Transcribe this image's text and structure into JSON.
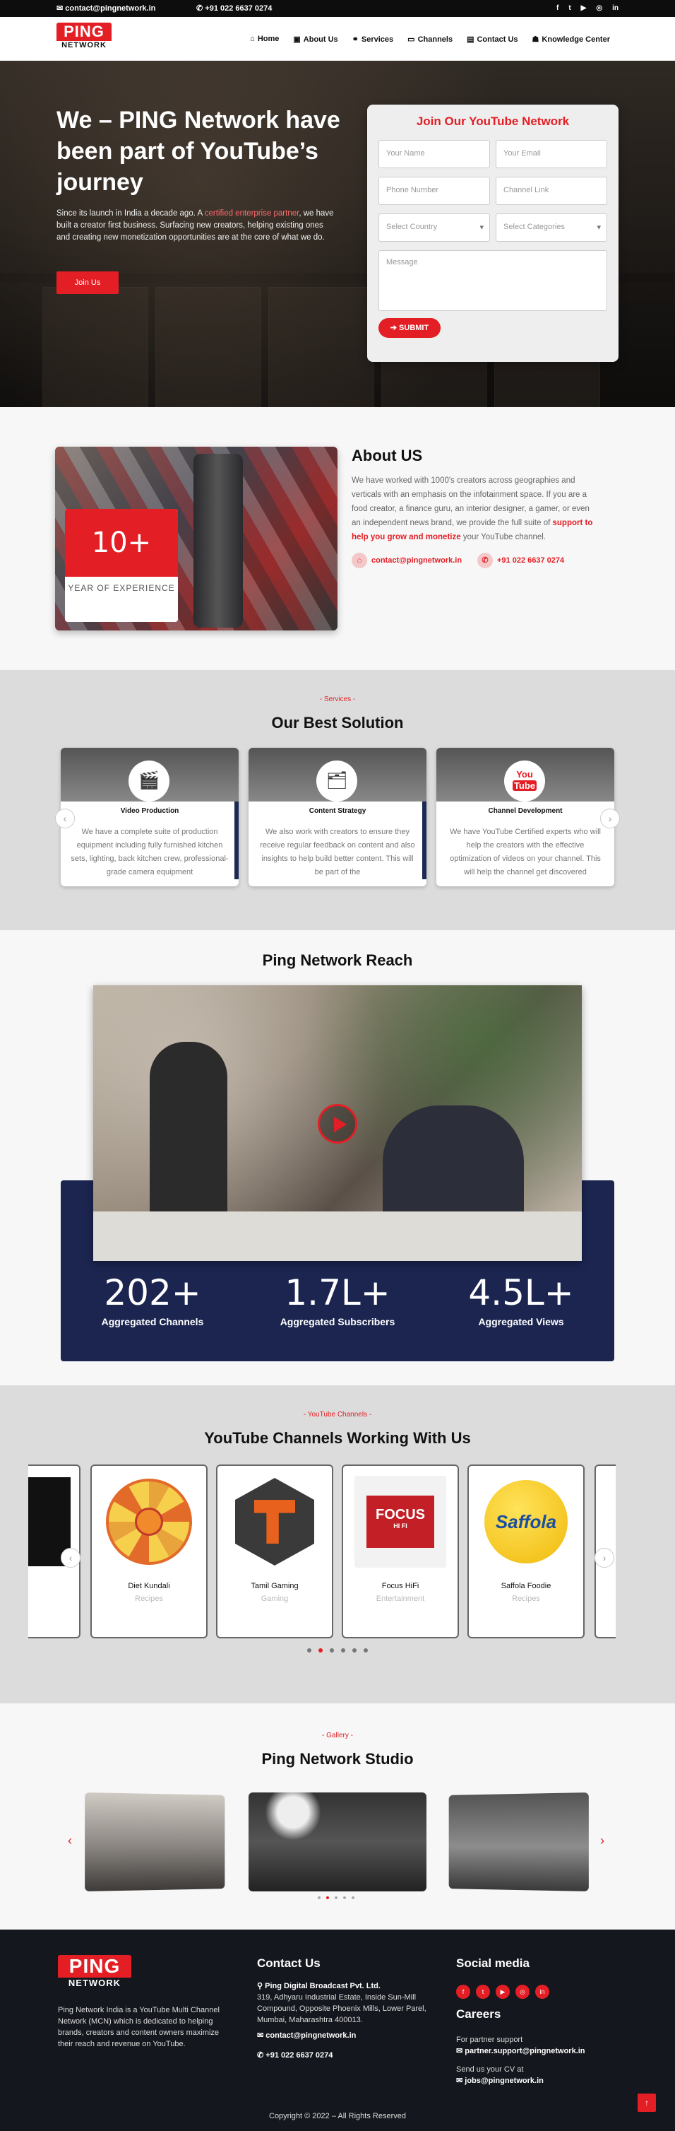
{
  "topbar": {
    "email": "contact@pingnetwork.in",
    "phone": "+91 022 6637 0274",
    "social_icons": [
      "facebook-icon",
      "twitter-icon",
      "youtube-icon",
      "instagram-icon",
      "linkedin-icon"
    ]
  },
  "brand": {
    "line1": "PING",
    "line2": "NETWORK"
  },
  "nav": {
    "items": [
      {
        "label": "Home",
        "icon": "home-icon"
      },
      {
        "label": "About Us",
        "icon": "id-card-icon"
      },
      {
        "label": "Services",
        "icon": "handshake-icon"
      },
      {
        "label": "Channels",
        "icon": "monitor-icon"
      },
      {
        "label": "Contact Us",
        "icon": "address-card-icon"
      },
      {
        "label": "Knowledge Center",
        "icon": "users-icon"
      }
    ]
  },
  "hero": {
    "title": "We – PING Network have been part of YouTube’s journey",
    "desc_a": "Since its launch in India a decade ago. A ",
    "desc_hl": "certified enterprise partner",
    "desc_b": ", we have built a creator first business. Surfacing new creators, helping existing ones and creating new monetization opportunities are at the core of what we do.",
    "button": "Join Us"
  },
  "form": {
    "title": "Join Our YouTube Network",
    "name": "Your Name",
    "email": "Your Email",
    "phone": "Phone Number",
    "channel": "Channel Link",
    "country": "Select Country",
    "category": "Select Categories",
    "message": "Message",
    "submit": "SUBMIT"
  },
  "about": {
    "heading": "About US",
    "text": "We have worked with 1000's creators across geographies and verticals with an emphasis on the infotainment space. If you are a food creator, a finance guru, an interior designer, a gamer, or even an independent news brand, we provide the full suite of ",
    "highlight": "support to help you grow and monetize",
    "text_end": " your YouTube channel.",
    "years": "10+",
    "years_label": "YEAR OF EXPERIENCE",
    "email": "contact@pingnetwork.in",
    "phone": "+91 022 6637 0274"
  },
  "solutions": {
    "tag": "- Services -",
    "title": "Our Best Solution",
    "cards": [
      {
        "name": "Video Production",
        "icon": "video-production-icon",
        "text": "We have a complete suite of production equipment including fully furnished kitchen sets, lighting, back kitchen crew, professional-grade camera equipment"
      },
      {
        "name": "Content Strategy",
        "icon": "content-strategy-icon",
        "text": "We also work with creators to ensure they receive regular feedback on content and also insights to help build better content. This will be part of the"
      },
      {
        "name": "Channel Development",
        "icon": "youtube-logo-icon",
        "text": "We have YouTube Certified experts who will help the creators with the effective optimization of videos on your channel. This will help the channel get discovered"
      }
    ]
  },
  "reach": {
    "title": "Ping Network Reach",
    "stats": [
      {
        "value": "202+",
        "label": "Aggregated Channels"
      },
      {
        "value": "1.7L+",
        "label": "Aggregated Subscribers"
      },
      {
        "value": "4.5L+",
        "label": "Aggregated Views"
      }
    ]
  },
  "channels": {
    "tag": "- YouTube Channels -",
    "title": "YouTube Channels Working With Us",
    "items": [
      {
        "name": "Diet Kundali",
        "category": "Recipes"
      },
      {
        "name": "Tamil Gaming",
        "category": "Gaming"
      },
      {
        "name": "Focus HiFi",
        "category": "Entertainment",
        "logo_text": "FOCUS",
        "logo_sub": "HI FI"
      },
      {
        "name": "Saffola Foodie",
        "category": "Recipes",
        "logo_text": "Saffola"
      }
    ]
  },
  "gallery": {
    "tag": "- Gallery -",
    "title": "Ping Network Studio"
  },
  "footer": {
    "desc": "Ping Network India is a YouTube Multi Channel Network (MCN) which is dedicated to helping brands, creators and content owners maximize their reach and revenue on YouTube.",
    "contact_title": "Contact Us",
    "company": "Ping Digital Broadcast Pvt. Ltd.",
    "address": "319, Adhyaru Industrial Estate, Inside Sun-Mill Compound, Opposite Phoenix Mills, Lower Parel, Mumbai, Maharashtra 400013.",
    "email": "contact@pingnetwork.in",
    "phone": "+91 022 6637 0274",
    "social_title": "Social media",
    "careers_title": "Careers",
    "partner_label": "For partner support",
    "partner_email": "partner.support@pingnetwork.in",
    "cv_label": "Send us your CV at",
    "cv_email": "jobs@pingnetwork.in",
    "copyright": "Copyright © 2022 – All Rights Reserved"
  }
}
